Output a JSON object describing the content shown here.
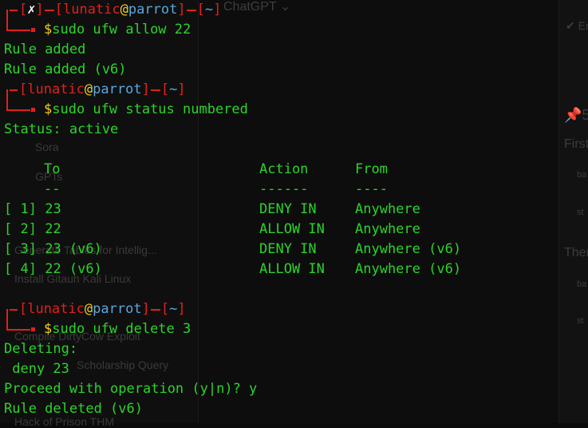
{
  "background_app": {
    "model_selector": "ChatGPT",
    "sidebar_items": [
      "Sora",
      "GPTs",
      "Generate Tables for Intellig...",
      "Install Gitauh Kali Linux",
      "Compile DirtyCow Exploit",
      "Scholarship Query",
      "Hack of Prison THM"
    ],
    "right_panel": [
      "Er",
      "5",
      "First",
      "ba",
      "st",
      "Ther",
      "ba",
      "st"
    ]
  },
  "terminal": {
    "prompt": {
      "user": "lunatic",
      "at": "@",
      "host": "parrot",
      "dir": "~",
      "fail_mark": "✗",
      "symbol": "$"
    },
    "blocks": [
      {
        "failed": true,
        "command": "sudo ufw allow 22",
        "output": [
          "Rule added",
          "Rule added (v6)"
        ]
      },
      {
        "failed": false,
        "command": "sudo ufw status numbered",
        "output": [
          "Status: active"
        ]
      },
      {
        "failed": false,
        "command": "sudo ufw delete 3",
        "output": [
          "Deleting:",
          " deny 23",
          "Proceed with operation (y|n)? y",
          "Rule deleted (v6)"
        ]
      }
    ],
    "table": {
      "headers": [
        "To",
        "Action",
        "From"
      ],
      "underlines": [
        "--",
        "------",
        "----"
      ],
      "rows": [
        {
          "num": "[ 1]",
          "to": "23",
          "action": "DENY IN",
          "from": "Anywhere"
        },
        {
          "num": "[ 2]",
          "to": "22",
          "action": "ALLOW IN",
          "from": "Anywhere"
        },
        {
          "num": "[ 3]",
          "to": "23 (v6)",
          "action": "DENY IN",
          "from": "Anywhere (v6)"
        },
        {
          "num": "[ 4]",
          "to": "22 (v6)",
          "action": "ALLOW IN",
          "from": "Anywhere (v6)"
        }
      ]
    }
  },
  "colors": {
    "prompt_red": "#e0201f",
    "text_green": "#2bd42b",
    "host_cyan": "#5aa7e0",
    "dollar_yellow": "#f2d01e"
  }
}
